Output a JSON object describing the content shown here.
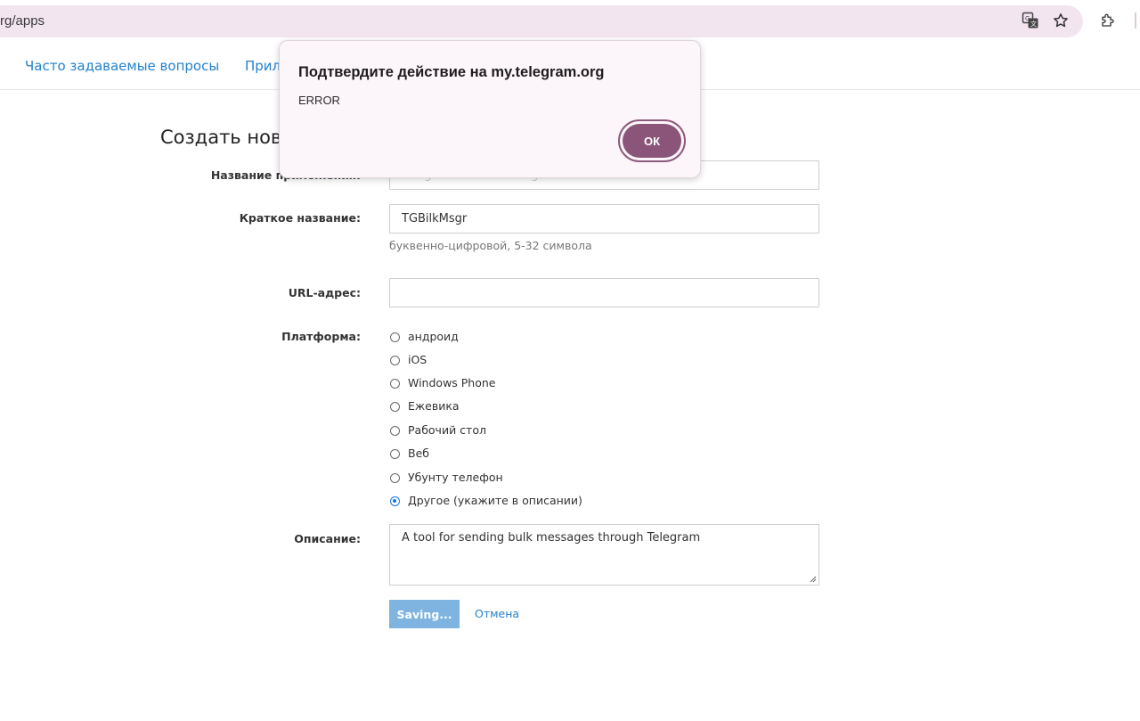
{
  "browser": {
    "url": "rg/apps"
  },
  "nav": {
    "faq": "Часто задаваемые вопросы",
    "apps": "Прил"
  },
  "form": {
    "title": "Создать нове",
    "app_title_label": "Название приложения:",
    "app_title_value": "Telegram Bulk Messenger",
    "short_name_label": "Краткое название:",
    "short_name_value": "TGBilkMsgr",
    "short_name_hint": "буквенно-цифровой, 5-32 символа",
    "url_label": "URL-адрес:",
    "url_value": "",
    "platform_label": "Платформа:",
    "platforms": [
      {
        "label": "андроид",
        "checked": false
      },
      {
        "label": "iOS",
        "checked": false
      },
      {
        "label": "Windows Phone",
        "checked": false
      },
      {
        "label": "Ежевика",
        "checked": false
      },
      {
        "label": "Рабочий стол",
        "checked": false
      },
      {
        "label": "Веб",
        "checked": false
      },
      {
        "label": "Убунту телефон",
        "checked": false
      },
      {
        "label": "Другое (укажите в описании)",
        "checked": true
      }
    ],
    "description_label": "Описание:",
    "description_value": "A tool for sending bulk messages through Telegram",
    "save_button": "Saving...",
    "cancel_link": "Отмена"
  },
  "dialog": {
    "title": "Подтвердите действие на my.telegram.org",
    "message": "ERROR",
    "ok_button": "ОК"
  },
  "colors": {
    "link": "#2481cc",
    "omnibox": "#f3e5f0",
    "dialog_bg": "#fcf6fa",
    "ok_button": "#8a5579",
    "save_button": "#7fb4e0",
    "radio_checked": "#1a73e8"
  }
}
